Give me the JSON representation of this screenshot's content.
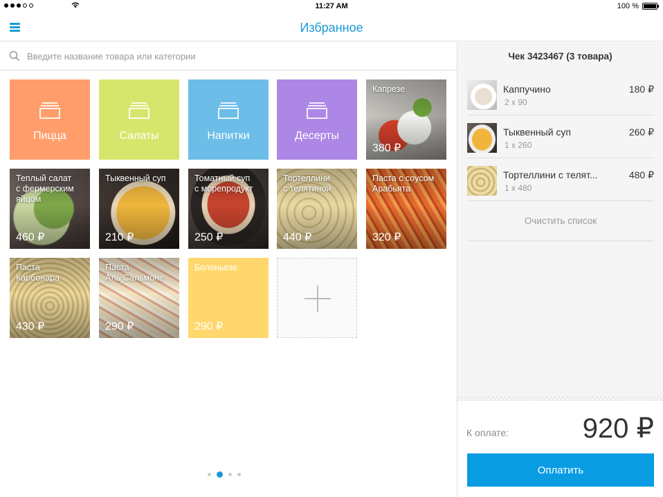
{
  "status_bar": {
    "time": "11:27 AM",
    "battery": "100 %",
    "signal_icon": "signal-dots-icon",
    "wifi_icon": "wifi-icon"
  },
  "nav": {
    "title": "Избранное",
    "menu_icon": "hamburger-menu-icon"
  },
  "search": {
    "placeholder": "Введите название товара или категории"
  },
  "categories": [
    {
      "label": "Пицца",
      "color": "#ff9e6b"
    },
    {
      "label": "Салаты",
      "color": "#d6e66c"
    },
    {
      "label": "Напитки",
      "color": "#6dbde9"
    },
    {
      "label": "Десерты",
      "color": "#ad87e6"
    }
  ],
  "products": [
    {
      "name": "Капрезе",
      "price": "380 ₽",
      "tag_color": "#cfe06a"
    },
    {
      "name": "Теплый салат\nс фермерским\nяйцом",
      "price": "460 ₽",
      "tag_color": "#cfe06a"
    },
    {
      "name": "Тыквенный суп",
      "price": "210 ₽",
      "tag_color": "#f06a6a"
    },
    {
      "name": "Томатный суп\nс морепродукт",
      "price": "250 ₽",
      "tag_color": "#f06a6a"
    },
    {
      "name": "Тортеллини\nс телятиной",
      "price": "440 ₽",
      "tag_color": ""
    },
    {
      "name": "Паста с соусом\nАрабьята",
      "price": "320 ₽",
      "tag_color": "#ffd76c"
    },
    {
      "name": "Паста\nКарбонара",
      "price": "430 ₽",
      "tag_color": "#ffd76c"
    },
    {
      "name": "Паста\nАль Сальмоне",
      "price": "290 ₽",
      "tag_color": "#ffd76c"
    },
    {
      "name": "Болоньезе",
      "price": "290 ₽",
      "tag_color": "#ffd76c",
      "solid": "#ffd76c"
    }
  ],
  "receipt": {
    "title": "Чек 3423467 (3 товара)",
    "items": [
      {
        "name": "Каппучино",
        "qty": "2 x 90",
        "price": "180 ₽"
      },
      {
        "name": "Тыквенный суп",
        "qty": "1 x 260",
        "price": "260 ₽"
      },
      {
        "name": "Тортеллини с телят...",
        "qty": "1 x 480",
        "price": "480 ₽"
      }
    ],
    "clear_label": "Очистить список",
    "total_label": "К оплате:",
    "total_value": "920 ₽",
    "pay_label": "Оплатить"
  },
  "pager": {
    "pages": 4,
    "active": 2
  },
  "colors": {
    "accent": "#1a9ad6",
    "pay_button": "#0a9ce3"
  }
}
